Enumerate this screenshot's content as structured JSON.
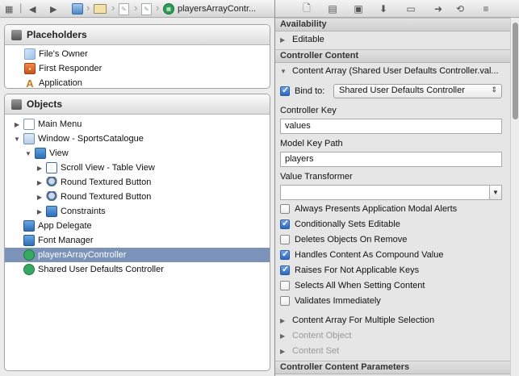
{
  "jump_bar": {
    "nav_back": "◀",
    "nav_forward": "▶",
    "current_item": "playersArrayContr..."
  },
  "placeholders": {
    "title": "Placeholders",
    "items": [
      {
        "label": "File's Owner",
        "icon": "cube-icon"
      },
      {
        "label": "First Responder",
        "icon": "first-responder-icon"
      },
      {
        "label": "Application",
        "icon": "application-icon"
      }
    ]
  },
  "objects": {
    "title": "Objects",
    "items": [
      {
        "label": "Main Menu",
        "icon": "menu-icon",
        "expanded": false,
        "depth": 0
      },
      {
        "label": "Window - SportsCatalogue",
        "icon": "window-icon",
        "expanded": true,
        "depth": 0
      },
      {
        "label": "View",
        "icon": "view-icon",
        "expanded": true,
        "depth": 1
      },
      {
        "label": "Scroll View - Table View",
        "icon": "scroll-view-icon",
        "expanded": false,
        "depth": 2
      },
      {
        "label": "Round Textured Button",
        "icon": "round-button-icon",
        "expanded": false,
        "depth": 2
      },
      {
        "label": "Round Textured Button",
        "icon": "round-button-icon",
        "expanded": false,
        "depth": 2
      },
      {
        "label": "Constraints",
        "icon": "constraints-icon",
        "expanded": false,
        "depth": 2
      },
      {
        "label": "App Delegate",
        "icon": "object-icon",
        "depth": 0
      },
      {
        "label": "Font Manager",
        "icon": "object-icon",
        "depth": 0
      },
      {
        "label": "playersArrayController",
        "icon": "array-controller-icon",
        "depth": 0,
        "selected": true
      },
      {
        "label": "Shared User Defaults Controller",
        "icon": "defaults-controller-icon",
        "depth": 0
      }
    ]
  },
  "inspector": {
    "availability": {
      "title": "Availability",
      "editable_label": "Editable"
    },
    "controller_content": {
      "title": "Controller Content",
      "content_array_label": "Content Array (Shared User Defaults Controller.val...",
      "bind_to_label": "Bind to:",
      "bind_to_checked": true,
      "bind_to_value": "Shared User Defaults Controller",
      "controller_key_label": "Controller Key",
      "controller_key_value": "values",
      "model_key_path_label": "Model Key Path",
      "model_key_path_value": "players",
      "value_transformer_label": "Value Transformer",
      "value_transformer_value": "",
      "options": [
        {
          "label": "Always Presents Application Modal Alerts",
          "checked": false
        },
        {
          "label": "Conditionally Sets Editable",
          "checked": true
        },
        {
          "label": "Deletes Objects On Remove",
          "checked": false
        },
        {
          "label": "Handles Content As Compound Value",
          "checked": true
        },
        {
          "label": "Raises For Not Applicable Keys",
          "checked": true
        },
        {
          "label": "Selects All When Setting Content",
          "checked": false
        },
        {
          "label": "Validates Immediately",
          "checked": false
        }
      ],
      "subsections": [
        {
          "label": "Content Array For Multiple Selection",
          "enabled": true
        },
        {
          "label": "Content Object",
          "enabled": false
        },
        {
          "label": "Content Set",
          "enabled": false
        }
      ]
    },
    "parameters_title": "Controller Content Parameters"
  }
}
